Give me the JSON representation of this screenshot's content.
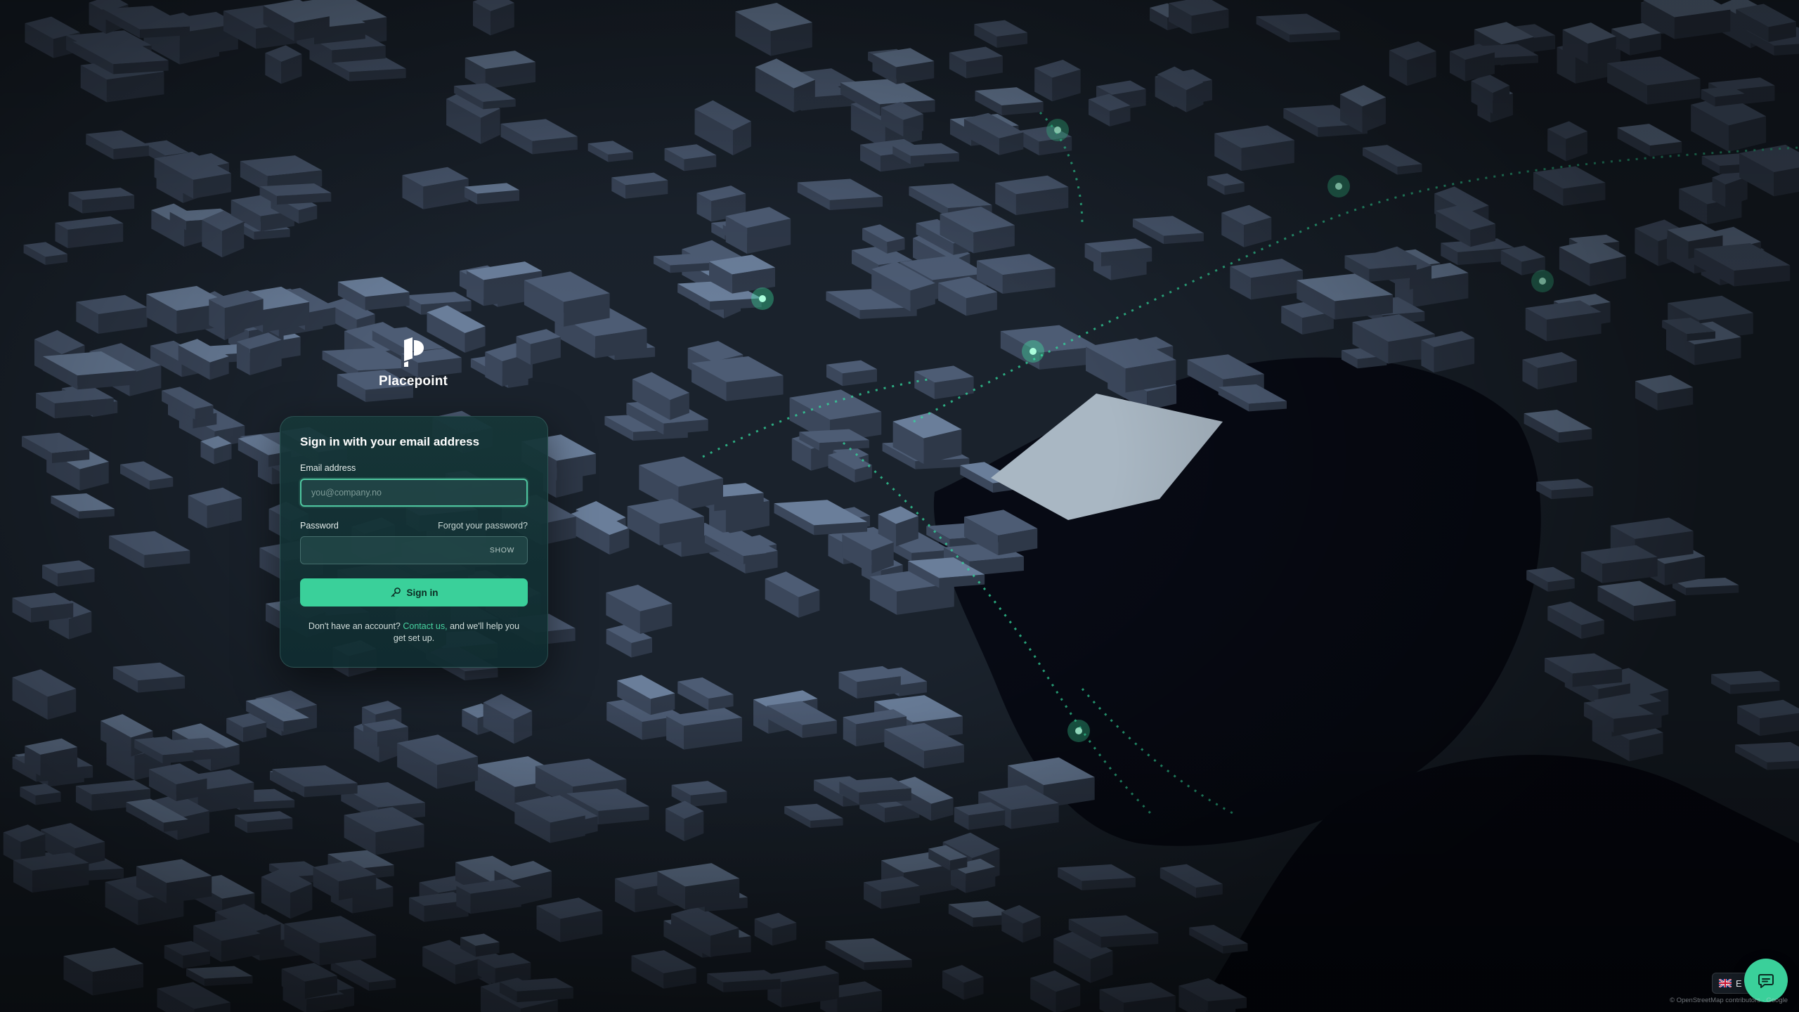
{
  "brand": {
    "name": "Placepoint",
    "logo_icon": "placepoint-logo-icon"
  },
  "login": {
    "heading": "Sign in with your email address",
    "email_label": "Email address",
    "email_placeholder": "you@company.no",
    "email_value": "",
    "password_label": "Password",
    "password_value": "",
    "forgot_link": "Forgot your password?",
    "show_toggle": "SHOW",
    "submit_label": "Sign in",
    "submit_icon": "key-icon",
    "signup_prefix": "Don't have an account?",
    "signup_link": "Contact us,",
    "signup_suffix": "and we'll help you get set up."
  },
  "language": {
    "flag_icon": "uk-flag-icon",
    "code": "E"
  },
  "chat": {
    "icon": "chat-bubble-icon"
  },
  "attribution": "© OpenStreetMap contributors · Google",
  "colors": {
    "accent": "#3ad09a",
    "card_background": "#163638",
    "page_background": "#0c1119"
  }
}
